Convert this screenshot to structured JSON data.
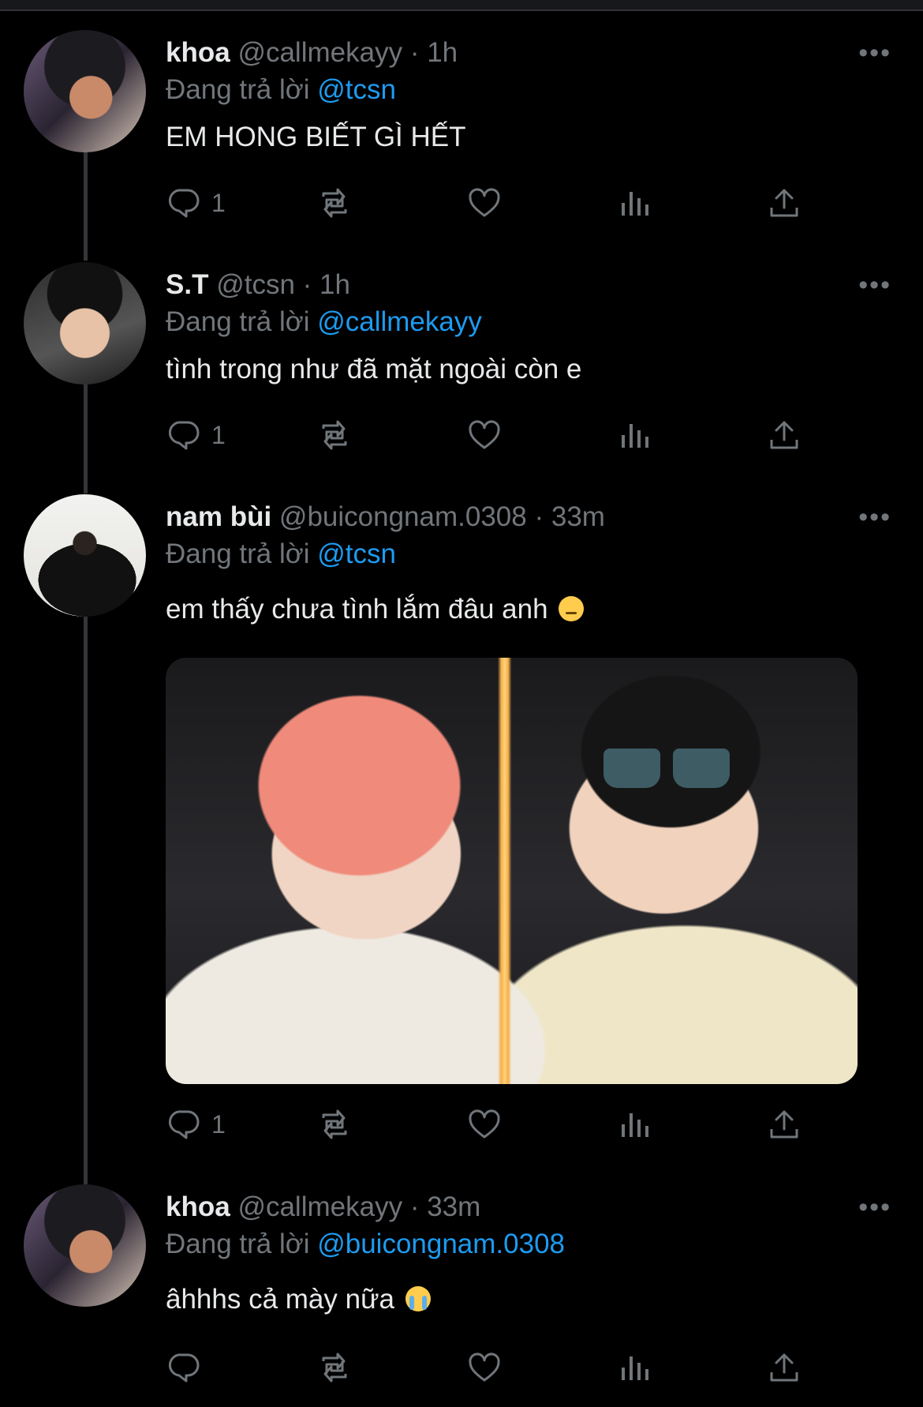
{
  "tweets": [
    {
      "name": "khoa",
      "handle": "@callmekayy",
      "time": "· 1h",
      "reply_prefix": "Đang trả lời",
      "reply_to": "@tcsn",
      "text": "EM HONG BIẾT GÌ HẾT",
      "reply_count": "1"
    },
    {
      "name": "S.T",
      "handle": "@tcsn",
      "time": "· 1h",
      "reply_prefix": "Đang trả lời",
      "reply_to": "@callmekayy",
      "text": "tình trong như đã mặt ngoài còn e",
      "reply_count": "1"
    },
    {
      "name": "nam bùi",
      "handle": "@buicongnam.0308",
      "time": "· 33m",
      "reply_prefix": "Đang trả lời",
      "reply_to": "@tcsn",
      "text": "em thấy chưa tình lắm đâu anh",
      "emoji": "pensive-face",
      "reply_count": "1"
    },
    {
      "name": "khoa",
      "handle": "@callmekayy",
      "time": "· 33m",
      "reply_prefix": "Đang trả lời",
      "reply_to": "@buicongnam.0308",
      "text": "âhhhs cả mày nữa",
      "emoji": "loudly-crying-face",
      "reply_count": ""
    }
  ],
  "more_label": "•••",
  "colors": {
    "background": "#000000",
    "text": "#e7e9ea",
    "muted": "#71767b",
    "link": "#1d9bf0",
    "thread_line": "#333639"
  }
}
